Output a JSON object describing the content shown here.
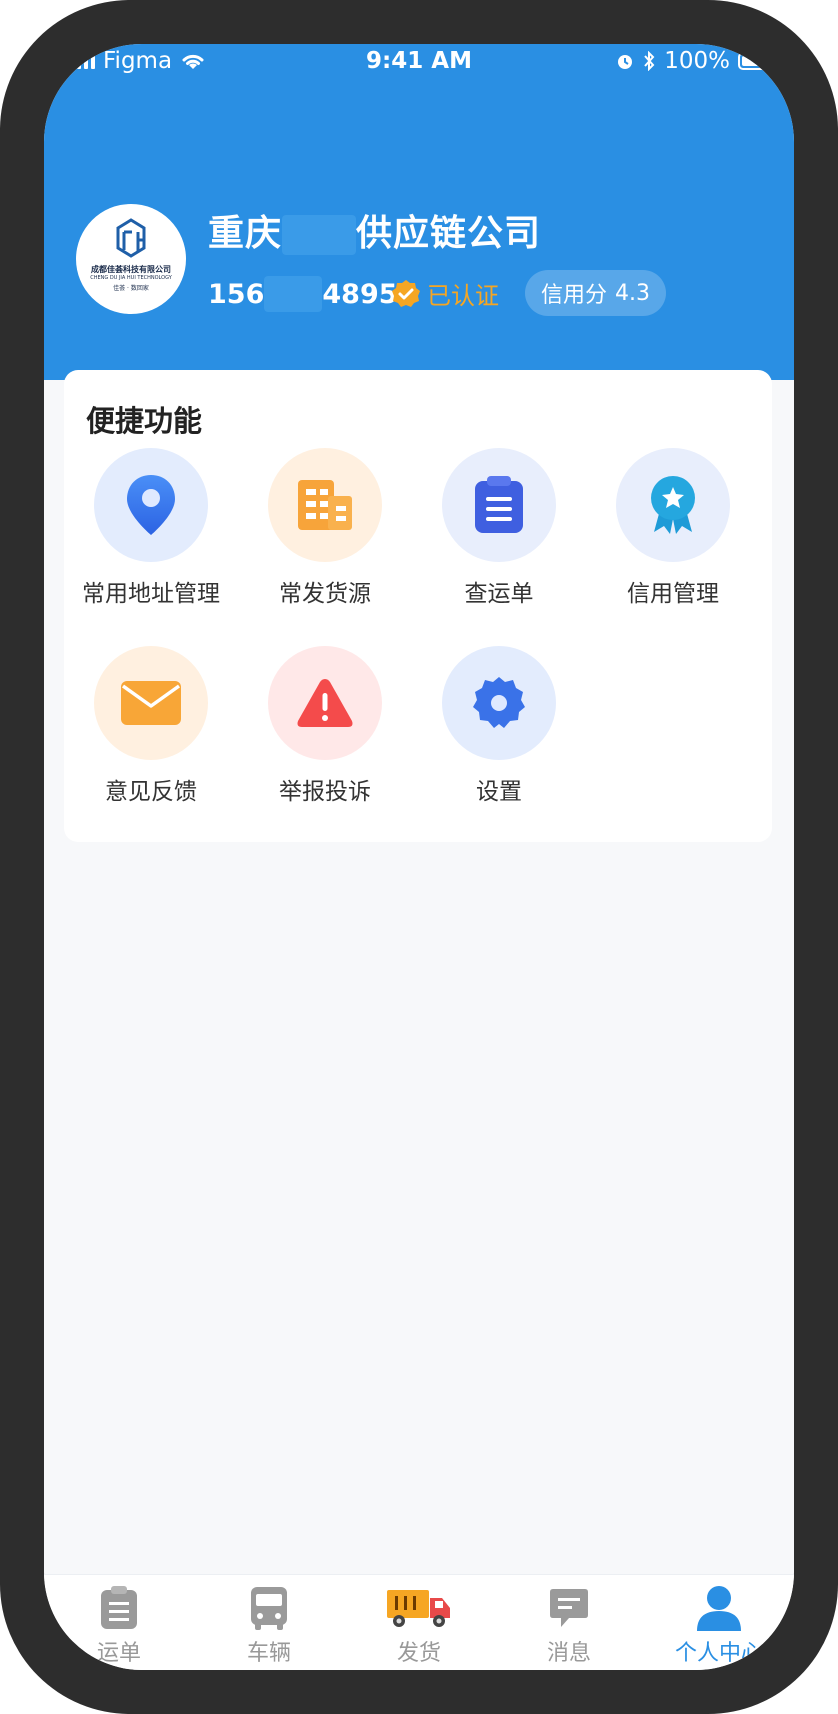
{
  "status_bar": {
    "carrier": "Figma",
    "time": "9:41 AM",
    "battery": "100%"
  },
  "profile": {
    "logo_line1": "成都佳荟科技有限公司",
    "logo_line2": "CHENG DU JIA HUI TECHNOLOGY",
    "logo_line3": "佳荟 · 数回家",
    "company_prefix": "重庆",
    "company_suffix": "供应链公司",
    "phone_prefix": "156",
    "phone_suffix": "4895",
    "verified_label": "已认证",
    "credit_label": "信用分",
    "credit_score": "4.3"
  },
  "shortcuts": {
    "title": "便捷功能",
    "items": [
      {
        "label": "常用地址管理",
        "icon": "location-pin-icon"
      },
      {
        "label": "常发货源",
        "icon": "building-icon"
      },
      {
        "label": "查运单",
        "icon": "clipboard-icon"
      },
      {
        "label": "信用管理",
        "icon": "award-ribbon-icon"
      },
      {
        "label": "意见反馈",
        "icon": "envelope-icon"
      },
      {
        "label": "举报投诉",
        "icon": "warning-icon"
      },
      {
        "label": "设置",
        "icon": "gear-icon"
      }
    ]
  },
  "tabbar": {
    "tabs": [
      {
        "label": "运单",
        "icon": "waybill-icon",
        "active": false
      },
      {
        "label": "车辆",
        "icon": "bus-icon",
        "active": false
      },
      {
        "label": "发货",
        "icon": "truck-icon",
        "active": false
      },
      {
        "label": "消息",
        "icon": "message-icon",
        "active": false
      },
      {
        "label": "个人中心",
        "icon": "person-icon",
        "active": true
      }
    ]
  },
  "colors": {
    "header_blue": "#2a8fe3",
    "verified_orange": "#f5a623",
    "active_tab": "#2a8fe3"
  }
}
